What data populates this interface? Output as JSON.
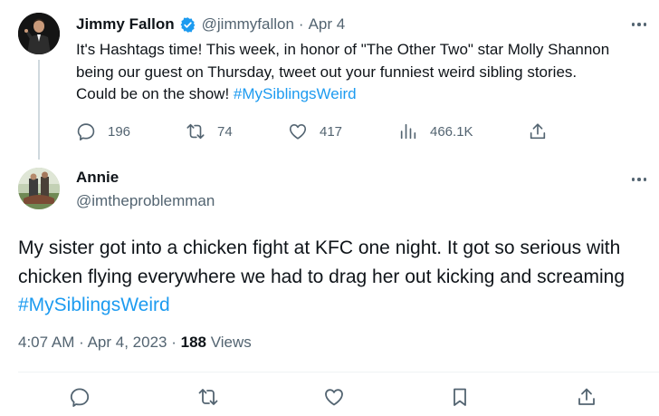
{
  "parent_tweet": {
    "author_name": "Jimmy Fallon",
    "author_handle": "@jimmyfallon",
    "separator": "·",
    "date": "Apr 4",
    "text_before": "It's Hashtags time! This week, in honor of \"The Other Two\" star Molly Shannon being our guest on Thursday, tweet out your funniest weird sibling stories. Could be on the show! ",
    "hashtag": "#MySiblingsWeird",
    "verified_color": "#1d9bf0",
    "actions": {
      "replies": "196",
      "retweets": "74",
      "likes": "417",
      "views": "466.1K"
    },
    "icons": [
      "reply-icon",
      "retweet-icon",
      "like-icon",
      "views-icon",
      "share-icon",
      "more-icon"
    ]
  },
  "reply_tweet": {
    "author_name": "Annie",
    "author_handle": "@imtheproblemman",
    "text_before": "My sister got into a chicken fight at KFC one night. It got so serious with chicken flying everywhere we had to drag her out kicking and screaming ",
    "hashtag": "#MySiblingsWeird",
    "time": "4:07 AM",
    "date": "Apr 4, 2023",
    "views_count": "188",
    "views_label": "Views",
    "separator": "·",
    "icons": [
      "reply-icon",
      "retweet-icon",
      "like-icon",
      "bookmark-icon",
      "share-icon",
      "more-icon"
    ]
  },
  "colors": {
    "text": "#0f1419",
    "secondary": "#536471",
    "link": "#1d9bf0",
    "border": "#eff3f4",
    "thread_line": "#cfd9de"
  }
}
